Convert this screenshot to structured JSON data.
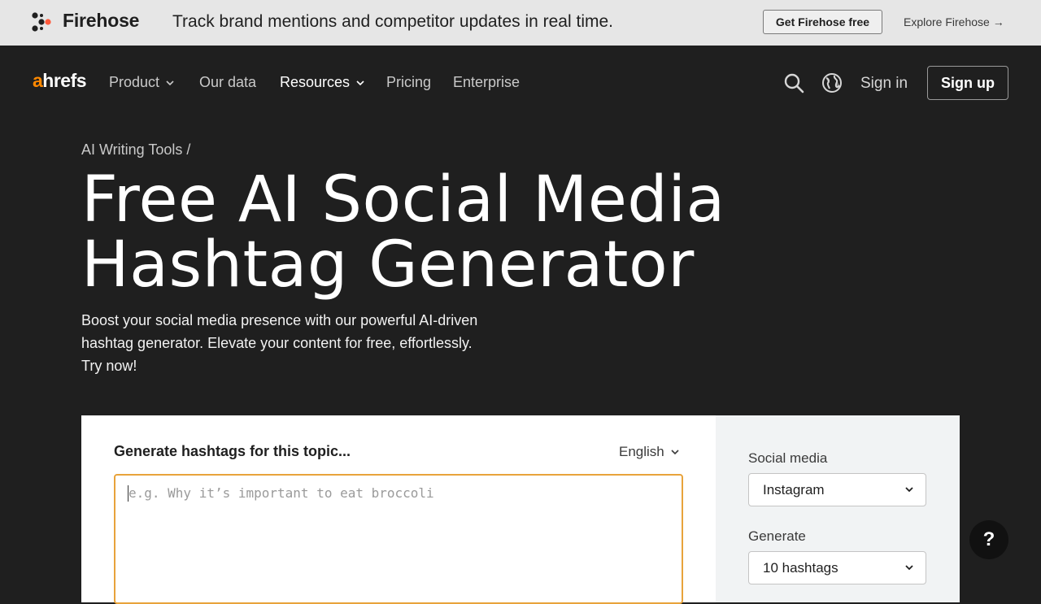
{
  "banner": {
    "brand": "Firehose",
    "tagline": "Track brand mentions and competitor updates in real time.",
    "cta": "Get Firehose free",
    "explore": "Explore Firehose →"
  },
  "nav": {
    "logo_a": "a",
    "logo_rest": "hrefs",
    "items": [
      {
        "label": "Product"
      },
      {
        "label": "Our data"
      },
      {
        "label": "Resources"
      },
      {
        "label": "Pricing"
      },
      {
        "label": "Enterprise"
      }
    ],
    "sign_in": "Sign in",
    "sign_up": "Sign up"
  },
  "hero": {
    "breadcrumb": "AI Writing Tools /",
    "title_line1": "Free AI Social Media",
    "title_line2": "Hashtag Generator",
    "subtitle": "Boost your social media presence with our powerful AI-driven hashtag generator. Elevate your content for free, effortlessly. Try now!"
  },
  "tool": {
    "topic_label": "Generate hashtags for this topic...",
    "language": "English",
    "topic_placeholder": "e.g. Why it’s important to eat broccoli",
    "topic_value": "",
    "social_label": "Social media",
    "social_value": "Instagram",
    "generate_label": "Generate",
    "generate_value": "10 hashtags"
  },
  "help": {
    "label": "?"
  },
  "colors": {
    "accent": "#ff8800",
    "input_focus": "#e8a33b",
    "dark_bg": "#1f1f1f"
  }
}
